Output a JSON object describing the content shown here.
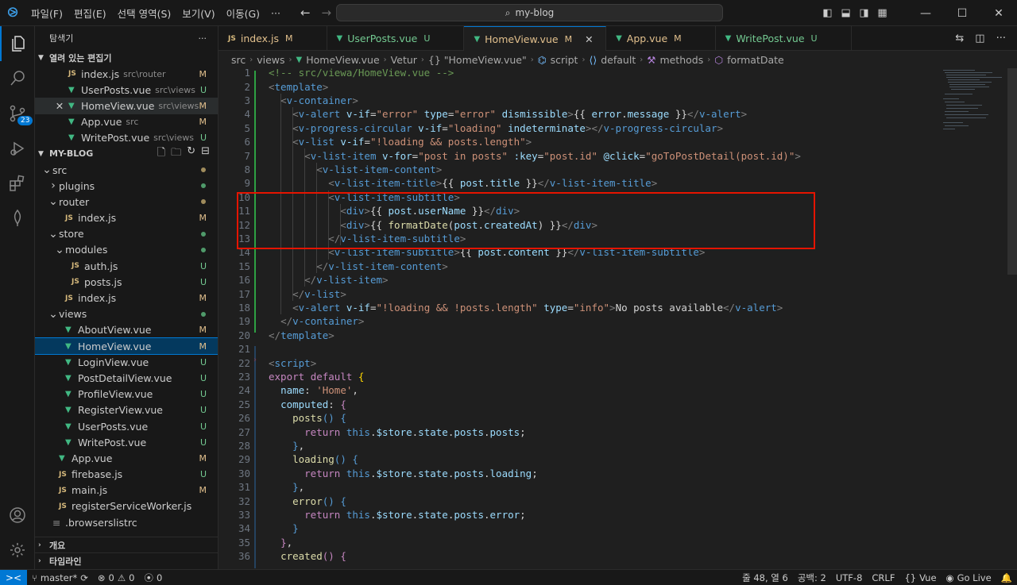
{
  "titlebar": {
    "menu": [
      "파일(F)",
      "편집(E)",
      "선택 영역(S)",
      "보기(V)",
      "이동(G)",
      "···"
    ],
    "search_text": "my-blog"
  },
  "activity": {
    "scm_badge": "23"
  },
  "sidebar": {
    "title": "탐색기",
    "more": "···",
    "open_editors_title": "열려 있는 편집기",
    "open_editors": [
      {
        "name": "index.js",
        "desc": "src\\router",
        "status": "M",
        "type": "js"
      },
      {
        "name": "UserPosts.vue",
        "desc": "src\\views",
        "status": "U",
        "type": "vue"
      },
      {
        "name": "HomeView.vue",
        "desc": "src\\views",
        "status": "M",
        "type": "vue",
        "close": "✕"
      },
      {
        "name": "App.vue",
        "desc": "src",
        "status": "M",
        "type": "vue"
      },
      {
        "name": "WritePost.vue",
        "desc": "src\\views",
        "status": "U",
        "type": "vue"
      }
    ],
    "project_title": "MY-BLOG",
    "tree": [
      {
        "name": "src",
        "kind": "folder-open",
        "indent": 0
      },
      {
        "name": "plugins",
        "kind": "folder-closed",
        "indent": 1
      },
      {
        "name": "router",
        "kind": "folder-open",
        "indent": 1
      },
      {
        "name": "index.js",
        "kind": "js",
        "indent": 2,
        "status": "M"
      },
      {
        "name": "store",
        "kind": "folder-open",
        "indent": 1
      },
      {
        "name": "modules",
        "kind": "folder-open",
        "indent": 2
      },
      {
        "name": "auth.js",
        "kind": "js",
        "indent": 3,
        "status": "U"
      },
      {
        "name": "posts.js",
        "kind": "js",
        "indent": 3,
        "status": "U"
      },
      {
        "name": "index.js",
        "kind": "js",
        "indent": 2,
        "status": "M"
      },
      {
        "name": "views",
        "kind": "folder-open",
        "indent": 1
      },
      {
        "name": "AboutView.vue",
        "kind": "vue",
        "indent": 2,
        "status": "M"
      },
      {
        "name": "HomeView.vue",
        "kind": "vue",
        "indent": 2,
        "status": "M"
      },
      {
        "name": "LoginView.vue",
        "kind": "vue",
        "indent": 2,
        "status": "U"
      },
      {
        "name": "PostDetailView.vue",
        "kind": "vue",
        "indent": 2,
        "status": "U"
      },
      {
        "name": "ProfileView.vue",
        "kind": "vue",
        "indent": 2,
        "status": "U"
      },
      {
        "name": "RegisterView.vue",
        "kind": "vue",
        "indent": 2,
        "status": "U"
      },
      {
        "name": "UserPosts.vue",
        "kind": "vue",
        "indent": 2,
        "status": "U"
      },
      {
        "name": "WritePost.vue",
        "kind": "vue",
        "indent": 2,
        "status": "U"
      },
      {
        "name": "App.vue",
        "kind": "vue",
        "indent": 1,
        "status": "M"
      },
      {
        "name": "firebase.js",
        "kind": "js",
        "indent": 1,
        "status": "U"
      },
      {
        "name": "main.js",
        "kind": "js",
        "indent": 1,
        "status": "M"
      },
      {
        "name": "registerServiceWorker.js",
        "kind": "js",
        "indent": 1
      },
      {
        "name": ".browserslistrc",
        "kind": "file",
        "indent": 0
      }
    ],
    "outline_title": "개요",
    "timeline_title": "타임라인"
  },
  "tabs": [
    {
      "name": "index.js",
      "status": "M",
      "type": "js"
    },
    {
      "name": "UserPosts.vue",
      "status": "U",
      "type": "vue"
    },
    {
      "name": "HomeView.vue",
      "status": "M",
      "type": "vue",
      "active": true,
      "close": "✕"
    },
    {
      "name": "App.vue",
      "status": "M",
      "type": "vue"
    },
    {
      "name": "WritePost.vue",
      "status": "U",
      "type": "vue"
    }
  ],
  "breadcrumb": [
    "src",
    "views",
    "HomeView.vue",
    "Vetur",
    "{} \"HomeView.vue\"",
    "script",
    "default",
    "methods",
    "formatDate"
  ],
  "code_lines": [
    [
      [
        "c",
        "<!-- src/viewa/HomeView.vue -->"
      ]
    ],
    [
      [
        "p",
        "<"
      ],
      [
        "t",
        "template"
      ],
      [
        "p",
        ">"
      ]
    ],
    [
      [
        "w",
        "  "
      ],
      [
        "p",
        "<"
      ],
      [
        "t",
        "v-container"
      ],
      [
        "p",
        ">"
      ]
    ],
    [
      [
        "w",
        "    "
      ],
      [
        "p",
        "<"
      ],
      [
        "t",
        "v-alert"
      ],
      [
        "w",
        " "
      ],
      [
        "a",
        "v-if"
      ],
      [
        "w",
        "="
      ],
      [
        "s",
        "\"error\""
      ],
      [
        "w",
        " "
      ],
      [
        "a",
        "type"
      ],
      [
        "w",
        "="
      ],
      [
        "s",
        "\"error\""
      ],
      [
        "w",
        " "
      ],
      [
        "a",
        "dismissible"
      ],
      [
        "p",
        ">"
      ],
      [
        "w",
        "{{ "
      ],
      [
        "v",
        "error"
      ],
      [
        "w",
        "."
      ],
      [
        "v",
        "message"
      ],
      [
        "w",
        " }}"
      ],
      [
        "p",
        "</"
      ],
      [
        "t",
        "v-alert"
      ],
      [
        "p",
        ">"
      ]
    ],
    [
      [
        "w",
        "    "
      ],
      [
        "p",
        "<"
      ],
      [
        "t",
        "v-progress-circular"
      ],
      [
        "w",
        " "
      ],
      [
        "a",
        "v-if"
      ],
      [
        "w",
        "="
      ],
      [
        "s",
        "\"loading\""
      ],
      [
        "w",
        " "
      ],
      [
        "a",
        "indeterminate"
      ],
      [
        "p",
        "></"
      ],
      [
        "t",
        "v-progress-circular"
      ],
      [
        "p",
        ">"
      ]
    ],
    [
      [
        "w",
        "    "
      ],
      [
        "p",
        "<"
      ],
      [
        "t",
        "v-list"
      ],
      [
        "w",
        " "
      ],
      [
        "a",
        "v-if"
      ],
      [
        "w",
        "="
      ],
      [
        "s",
        "\"!loading && posts.length\""
      ],
      [
        "p",
        ">"
      ]
    ],
    [
      [
        "w",
        "      "
      ],
      [
        "p",
        "<"
      ],
      [
        "t",
        "v-list-item"
      ],
      [
        "w",
        " "
      ],
      [
        "a",
        "v-for"
      ],
      [
        "w",
        "="
      ],
      [
        "s",
        "\"post in posts\""
      ],
      [
        "w",
        " "
      ],
      [
        "a",
        ":key"
      ],
      [
        "w",
        "="
      ],
      [
        "s",
        "\"post.id\""
      ],
      [
        "w",
        " "
      ],
      [
        "a",
        "@click"
      ],
      [
        "w",
        "="
      ],
      [
        "s",
        "\"goToPostDetail(post.id)\""
      ],
      [
        "p",
        ">"
      ]
    ],
    [
      [
        "w",
        "        "
      ],
      [
        "p",
        "<"
      ],
      [
        "t",
        "v-list-item-content"
      ],
      [
        "p",
        ">"
      ]
    ],
    [
      [
        "w",
        "          "
      ],
      [
        "p",
        "<"
      ],
      [
        "t",
        "v-list-item-title"
      ],
      [
        "p",
        ">"
      ],
      [
        "w",
        "{{ "
      ],
      [
        "v",
        "post"
      ],
      [
        "w",
        "."
      ],
      [
        "v",
        "title"
      ],
      [
        "w",
        " }}"
      ],
      [
        "p",
        "</"
      ],
      [
        "t",
        "v-list-item-title"
      ],
      [
        "p",
        ">"
      ]
    ],
    [
      [
        "w",
        "          "
      ],
      [
        "p",
        "<"
      ],
      [
        "t",
        "v-list-item-subtitle"
      ],
      [
        "p",
        ">"
      ]
    ],
    [
      [
        "w",
        "            "
      ],
      [
        "p",
        "<"
      ],
      [
        "t",
        "div"
      ],
      [
        "p",
        ">"
      ],
      [
        "w",
        "{{ "
      ],
      [
        "v",
        "post"
      ],
      [
        "w",
        "."
      ],
      [
        "v",
        "userName"
      ],
      [
        "w",
        " }}"
      ],
      [
        "p",
        "</"
      ],
      [
        "t",
        "div"
      ],
      [
        "p",
        ">"
      ]
    ],
    [
      [
        "w",
        "            "
      ],
      [
        "p",
        "<"
      ],
      [
        "t",
        "div"
      ],
      [
        "p",
        ">"
      ],
      [
        "w",
        "{{ "
      ],
      [
        "f",
        "formatDate"
      ],
      [
        "w",
        "("
      ],
      [
        "v",
        "post"
      ],
      [
        "w",
        "."
      ],
      [
        "v",
        "createdAt"
      ],
      [
        "w",
        ") }}"
      ],
      [
        "p",
        "</"
      ],
      [
        "t",
        "div"
      ],
      [
        "p",
        ">"
      ]
    ],
    [
      [
        "w",
        "          "
      ],
      [
        "p",
        "</"
      ],
      [
        "t",
        "v-list-item-subtitle"
      ],
      [
        "p",
        ">"
      ]
    ],
    [
      [
        "w",
        "          "
      ],
      [
        "p",
        "<"
      ],
      [
        "t",
        "v-list-item-subtitle"
      ],
      [
        "p",
        ">"
      ],
      [
        "w",
        "{{ "
      ],
      [
        "v",
        "post"
      ],
      [
        "w",
        "."
      ],
      [
        "v",
        "content"
      ],
      [
        "w",
        " }}"
      ],
      [
        "p",
        "</"
      ],
      [
        "t",
        "v-list-item-subtitle"
      ],
      [
        "p",
        ">"
      ]
    ],
    [
      [
        "w",
        "        "
      ],
      [
        "p",
        "</"
      ],
      [
        "t",
        "v-list-item-content"
      ],
      [
        "p",
        ">"
      ]
    ],
    [
      [
        "w",
        "      "
      ],
      [
        "p",
        "</"
      ],
      [
        "t",
        "v-list-item"
      ],
      [
        "p",
        ">"
      ]
    ],
    [
      [
        "w",
        "    "
      ],
      [
        "p",
        "</"
      ],
      [
        "t",
        "v-list"
      ],
      [
        "p",
        ">"
      ]
    ],
    [
      [
        "w",
        "    "
      ],
      [
        "p",
        "<"
      ],
      [
        "t",
        "v-alert"
      ],
      [
        "w",
        " "
      ],
      [
        "a",
        "v-if"
      ],
      [
        "w",
        "="
      ],
      [
        "s",
        "\"!loading && !posts.length\""
      ],
      [
        "w",
        " "
      ],
      [
        "a",
        "type"
      ],
      [
        "w",
        "="
      ],
      [
        "s",
        "\"info\""
      ],
      [
        "p",
        ">"
      ],
      [
        "w",
        "No posts available"
      ],
      [
        "p",
        "</"
      ],
      [
        "t",
        "v-alert"
      ],
      [
        "p",
        ">"
      ]
    ],
    [
      [
        "w",
        "  "
      ],
      [
        "p",
        "</"
      ],
      [
        "t",
        "v-container"
      ],
      [
        "p",
        ">"
      ]
    ],
    [
      [
        "p",
        "</"
      ],
      [
        "t",
        "template"
      ],
      [
        "p",
        ">"
      ]
    ],
    [],
    [
      [
        "p",
        "<"
      ],
      [
        "t",
        "script"
      ],
      [
        "p",
        ">"
      ]
    ],
    [
      [
        "k",
        "export"
      ],
      [
        "w",
        " "
      ],
      [
        "k",
        "default"
      ],
      [
        "w",
        " "
      ],
      [
        "y",
        "{"
      ]
    ],
    [
      [
        "w",
        "  "
      ],
      [
        "v",
        "name"
      ],
      [
        "w",
        ": "
      ],
      [
        "s",
        "'Home'"
      ],
      [
        "w",
        ","
      ]
    ],
    [
      [
        "w",
        "  "
      ],
      [
        "v",
        "computed"
      ],
      [
        "w",
        ": "
      ],
      [
        "k",
        "{"
      ]
    ],
    [
      [
        "w",
        "    "
      ],
      [
        "f",
        "posts"
      ],
      [
        "b",
        "()"
      ],
      [
        "w",
        " "
      ],
      [
        "b",
        "{"
      ]
    ],
    [
      [
        "w",
        "      "
      ],
      [
        "k",
        "return"
      ],
      [
        "w",
        " "
      ],
      [
        "b",
        "this"
      ],
      [
        "w",
        "."
      ],
      [
        "v",
        "$store"
      ],
      [
        "w",
        "."
      ],
      [
        "v",
        "state"
      ],
      [
        "w",
        "."
      ],
      [
        "v",
        "posts"
      ],
      [
        "w",
        "."
      ],
      [
        "v",
        "posts"
      ],
      [
        "w",
        ";"
      ]
    ],
    [
      [
        "w",
        "    "
      ],
      [
        "b",
        "}"
      ],
      [
        "w",
        ","
      ]
    ],
    [
      [
        "w",
        "    "
      ],
      [
        "f",
        "loading"
      ],
      [
        "b",
        "()"
      ],
      [
        "w",
        " "
      ],
      [
        "b",
        "{"
      ]
    ],
    [
      [
        "w",
        "      "
      ],
      [
        "k",
        "return"
      ],
      [
        "w",
        " "
      ],
      [
        "b",
        "this"
      ],
      [
        "w",
        "."
      ],
      [
        "v",
        "$store"
      ],
      [
        "w",
        "."
      ],
      [
        "v",
        "state"
      ],
      [
        "w",
        "."
      ],
      [
        "v",
        "posts"
      ],
      [
        "w",
        "."
      ],
      [
        "v",
        "loading"
      ],
      [
        "w",
        ";"
      ]
    ],
    [
      [
        "w",
        "    "
      ],
      [
        "b",
        "}"
      ],
      [
        "w",
        ","
      ]
    ],
    [
      [
        "w",
        "    "
      ],
      [
        "f",
        "error"
      ],
      [
        "b",
        "()"
      ],
      [
        "w",
        " "
      ],
      [
        "b",
        "{"
      ]
    ],
    [
      [
        "w",
        "      "
      ],
      [
        "k",
        "return"
      ],
      [
        "w",
        " "
      ],
      [
        "b",
        "this"
      ],
      [
        "w",
        "."
      ],
      [
        "v",
        "$store"
      ],
      [
        "w",
        "."
      ],
      [
        "v",
        "state"
      ],
      [
        "w",
        "."
      ],
      [
        "v",
        "posts"
      ],
      [
        "w",
        "."
      ],
      [
        "v",
        "error"
      ],
      [
        "w",
        ";"
      ]
    ],
    [
      [
        "w",
        "    "
      ],
      [
        "b",
        "}"
      ]
    ],
    [
      [
        "w",
        "  "
      ],
      [
        "k",
        "}"
      ],
      [
        "w",
        ","
      ]
    ],
    [
      [
        "w",
        "  "
      ],
      [
        "f",
        "created"
      ],
      [
        "k",
        "()"
      ],
      [
        "w",
        " "
      ],
      [
        "k",
        "{"
      ]
    ]
  ],
  "status": {
    "remote": "><",
    "branch": "master*",
    "problems": "0",
    "warnings": "0",
    "ports": "0",
    "position": "줄 48, 열 6",
    "indent": "공백: 2",
    "encoding": "UTF-8",
    "eol": "CRLF",
    "language": "Vue",
    "golive": "Go Live"
  }
}
